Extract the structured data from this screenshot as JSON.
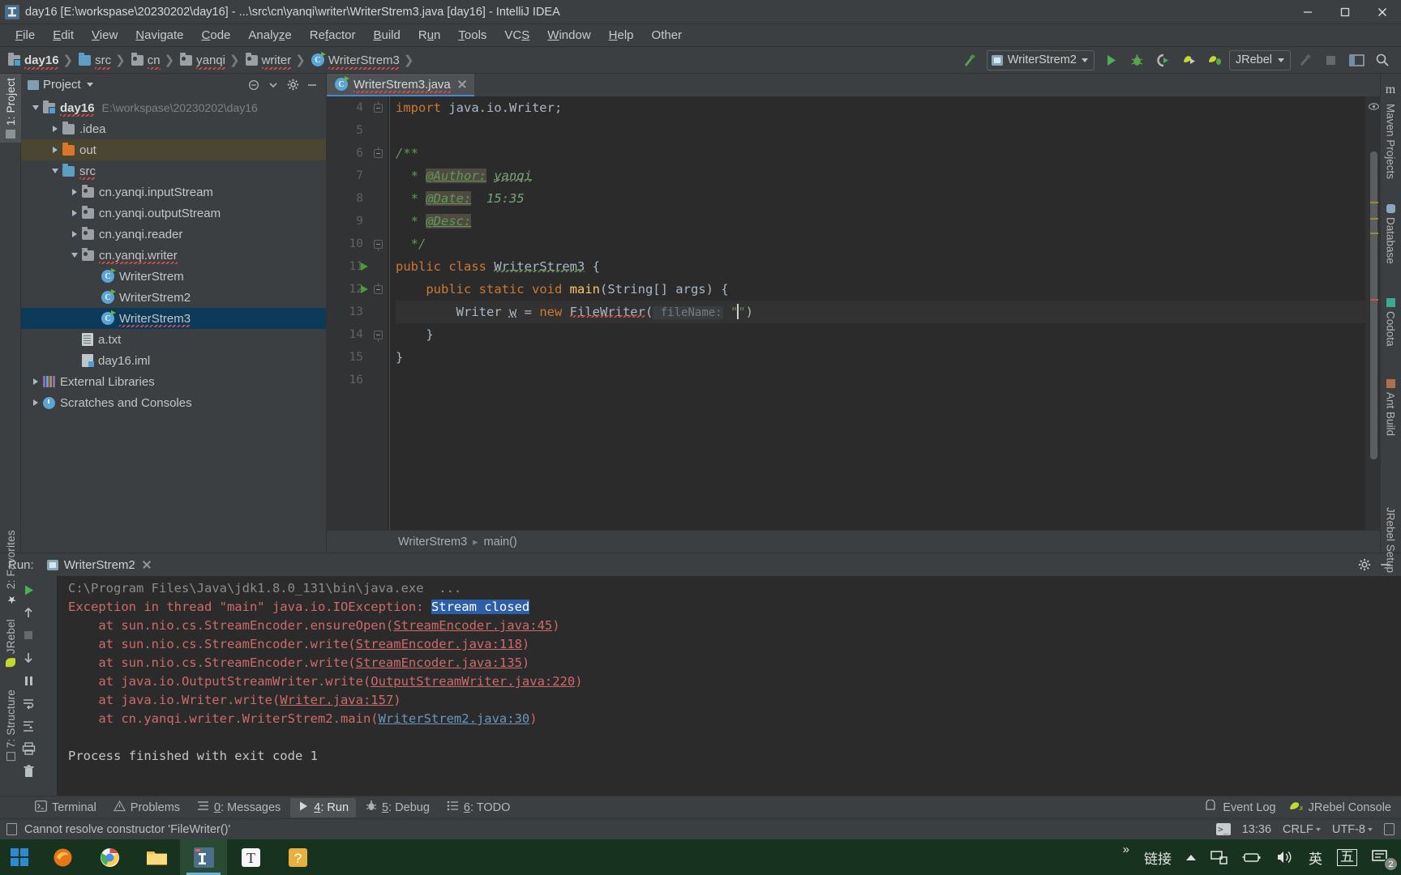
{
  "window": {
    "title": "day16 [E:\\workspase\\20230202\\day16] - ...\\src\\cn\\yanqi\\writer\\WriterStrem3.java [day16] - IntelliJ IDEA",
    "minimize_label": "Minimize",
    "maximize_label": "Maximize",
    "close_label": "Close"
  },
  "menubar": {
    "items": [
      {
        "label": "File"
      },
      {
        "label": "Edit"
      },
      {
        "label": "View"
      },
      {
        "label": "Navigate"
      },
      {
        "label": "Code"
      },
      {
        "label": "Analyze"
      },
      {
        "label": "Refactor"
      },
      {
        "label": "Build"
      },
      {
        "label": "Run"
      },
      {
        "label": "Tools"
      },
      {
        "label": "VCS"
      },
      {
        "label": "Window"
      },
      {
        "label": "Help"
      },
      {
        "label": "Other"
      }
    ]
  },
  "navbar": {
    "breadcrumbs": [
      {
        "label": "day16",
        "icon": "module-icon"
      },
      {
        "label": "src",
        "icon": "source-folder-icon"
      },
      {
        "label": "cn",
        "icon": "package-icon"
      },
      {
        "label": "yanqi",
        "icon": "package-icon"
      },
      {
        "label": "writer",
        "icon": "package-icon"
      },
      {
        "label": "WriterStrem3",
        "icon": "java-class-icon"
      }
    ],
    "run_config": "WriterStrem2",
    "jrebel_label": "JRebel",
    "buttons": [
      {
        "name": "build-hammer-icon"
      },
      {
        "name": "run-icon"
      },
      {
        "name": "debug-icon"
      },
      {
        "name": "run-with-coverage-icon"
      },
      {
        "name": "jrebel-run-icon"
      },
      {
        "name": "jrebel-debug-icon"
      },
      {
        "name": "attach-profiler-icon"
      },
      {
        "name": "stop-icon"
      },
      {
        "name": "layout-icon"
      },
      {
        "name": "search-everywhere-icon"
      }
    ]
  },
  "left_strip": {
    "tabs": [
      {
        "label": "1: Project",
        "selected": true
      },
      {
        "label": "2: Favorites",
        "selected": false
      },
      {
        "label": "JRebel",
        "selected": false
      },
      {
        "label": "7: Structure",
        "selected": false
      }
    ]
  },
  "right_strip": {
    "tabs": [
      {
        "label": "m"
      },
      {
        "label": "Maven Projects"
      },
      {
        "label": "Database"
      },
      {
        "label": "Codota"
      },
      {
        "label": "Ant Build"
      },
      {
        "label": "JRebel Setup Wizard"
      }
    ]
  },
  "project_panel": {
    "title": "Project",
    "actions": [
      "collapse-all-icon",
      "expand-icon",
      "settings-gear-icon",
      "hide-icon"
    ],
    "tree": [
      {
        "depth": 0,
        "arrow": "open",
        "icon": "module-icon",
        "name": "day16",
        "bold": true,
        "path": "E:\\workspase\\20230202\\day16",
        "state": "normal"
      },
      {
        "depth": 1,
        "arrow": "closed",
        "icon": "folder-grey-icon",
        "name": ".idea",
        "bold": false,
        "path": "",
        "state": "normal"
      },
      {
        "depth": 1,
        "arrow": "closed",
        "icon": "folder-orange-icon",
        "name": "out",
        "bold": false,
        "path": "",
        "state": "highlight"
      },
      {
        "depth": 1,
        "arrow": "open",
        "icon": "folder-source-icon",
        "name": "src",
        "bold": false,
        "path": "",
        "state": "normal"
      },
      {
        "depth": 2,
        "arrow": "closed",
        "icon": "package-icon",
        "name": "cn.yanqi.inputStream",
        "bold": false,
        "path": "",
        "state": "normal"
      },
      {
        "depth": 2,
        "arrow": "closed",
        "icon": "package-icon",
        "name": "cn.yanqi.outputStream",
        "bold": false,
        "path": "",
        "state": "normal"
      },
      {
        "depth": 2,
        "arrow": "closed",
        "icon": "package-icon",
        "name": "cn.yanqi.reader",
        "bold": false,
        "path": "",
        "state": "normal"
      },
      {
        "depth": 2,
        "arrow": "open",
        "icon": "package-icon",
        "name": "cn.yanqi.writer",
        "bold": false,
        "path": "",
        "state": "normal"
      },
      {
        "depth": 3,
        "arrow": "none",
        "icon": "java-class-icon",
        "name": "WriterStrem",
        "bold": false,
        "path": "",
        "state": "normal"
      },
      {
        "depth": 3,
        "arrow": "none",
        "icon": "java-class-icon",
        "name": "WriterStrem2",
        "bold": false,
        "path": "",
        "state": "normal"
      },
      {
        "depth": 3,
        "arrow": "none",
        "icon": "java-class-icon",
        "name": "WriterStrem3",
        "bold": false,
        "path": "",
        "state": "selected"
      },
      {
        "depth": 2,
        "arrow": "none",
        "icon": "text-file-icon",
        "name": "a.txt",
        "bold": false,
        "path": "",
        "state": "normal"
      },
      {
        "depth": 2,
        "arrow": "none",
        "icon": "iml-file-icon",
        "name": "day16.iml",
        "bold": false,
        "path": "",
        "state": "normal"
      },
      {
        "depth": 0,
        "arrow": "closed",
        "icon": "library-icon",
        "name": "External Libraries",
        "bold": false,
        "path": "",
        "state": "normal"
      },
      {
        "depth": 0,
        "arrow": "closed",
        "icon": "scratch-icon",
        "name": "Scratches and Consoles",
        "bold": false,
        "path": "",
        "state": "normal"
      }
    ]
  },
  "editor": {
    "tab": {
      "label": "WriterStrem3.java",
      "close_label": "Close tab"
    },
    "first_visible_line": 4,
    "lines": [
      {
        "num": 4,
        "run_marker": false,
        "fold": "top",
        "current": false,
        "tokens": [
          {
            "t": "import ",
            "c": "k"
          },
          {
            "t": "java.io.Writer;",
            "c": "id"
          }
        ]
      },
      {
        "num": 5,
        "run_marker": false,
        "fold": "",
        "current": false,
        "tokens": []
      },
      {
        "num": 6,
        "run_marker": false,
        "fold": "top",
        "current": false,
        "tokens": [
          {
            "t": "/**",
            "c": "cm"
          }
        ]
      },
      {
        "num": 7,
        "run_marker": false,
        "fold": "",
        "current": false,
        "tokens": [
          {
            "t": "  * ",
            "c": "cm"
          },
          {
            "t": "@Author:",
            "c": "tag"
          },
          {
            "t": " ",
            "c": "cm"
          },
          {
            "t": "yanqi",
            "c": "cmv-squig"
          }
        ]
      },
      {
        "num": 8,
        "run_marker": false,
        "fold": "",
        "current": false,
        "tokens": [
          {
            "t": "  * ",
            "c": "cm"
          },
          {
            "t": "@Date:",
            "c": "tag"
          },
          {
            "t": "  15:35",
            "c": "cmv"
          }
        ]
      },
      {
        "num": 9,
        "run_marker": false,
        "fold": "",
        "current": false,
        "tokens": [
          {
            "t": "  * ",
            "c": "cm"
          },
          {
            "t": "@Desc:",
            "c": "tag"
          }
        ]
      },
      {
        "num": 10,
        "run_marker": false,
        "fold": "bottom",
        "current": false,
        "tokens": [
          {
            "t": "  */",
            "c": "cm"
          }
        ]
      },
      {
        "num": 11,
        "run_marker": true,
        "fold": "",
        "current": false,
        "tokens": [
          {
            "t": "public class ",
            "c": "k"
          },
          {
            "t": "WriterStrem3",
            "c": "id-squig"
          },
          {
            "t": " {",
            "c": "id"
          }
        ]
      },
      {
        "num": 12,
        "run_marker": true,
        "fold": "top",
        "current": false,
        "tokens": [
          {
            "t": "    ",
            "c": "id"
          },
          {
            "t": "public static ",
            "c": "k"
          },
          {
            "t": "void ",
            "c": "k"
          },
          {
            "t": "main",
            "c": "mn"
          },
          {
            "t": "(String[] args) {",
            "c": "id"
          }
        ]
      },
      {
        "num": 13,
        "run_marker": false,
        "fold": "",
        "current": true,
        "tokens": [
          {
            "t": "        Writer ",
            "c": "id"
          },
          {
            "t": "w",
            "c": "fld"
          },
          {
            "t": " = ",
            "c": "id"
          },
          {
            "t": "new ",
            "c": "k"
          },
          {
            "t": "FileWriter",
            "c": "id-err"
          },
          {
            "t": "(",
            "c": "id"
          },
          {
            "t": " fileName:",
            "c": "hint"
          },
          {
            "t": " ",
            "c": "id"
          },
          {
            "t": "\"",
            "c": "str"
          },
          {
            "t": "|CARET|",
            "c": "caret"
          },
          {
            "t": "\"",
            "c": "str"
          },
          {
            "t": ")",
            "c": "id"
          }
        ]
      },
      {
        "num": 14,
        "run_marker": false,
        "fold": "bottom",
        "current": false,
        "tokens": [
          {
            "t": "    }",
            "c": "id"
          }
        ]
      },
      {
        "num": 15,
        "run_marker": false,
        "fold": "",
        "current": false,
        "tokens": [
          {
            "t": "}",
            "c": "id"
          }
        ]
      },
      {
        "num": 16,
        "run_marker": false,
        "fold": "",
        "current": false,
        "tokens": []
      }
    ],
    "breadcrumb": [
      "WriterStrem3",
      "main()"
    ]
  },
  "run_panel": {
    "label": "Run:",
    "tab_name": "WriterStrem2",
    "tab_close_label": "Close",
    "gutter_buttons": [
      "rerun-icon",
      "up-arrow-icon",
      "stop-icon",
      "down-arrow-icon",
      "pause-icon",
      "soft-wrap-icon",
      "scroll-to-end-icon",
      "print-icon",
      "trash-icon"
    ],
    "settings_label": "Settings",
    "minimize_label": "Hide",
    "console": [
      {
        "type": "cmd",
        "text": "C:\\Program Files\\Java\\jdk1.8.0_131\\bin\\java.exe  ..."
      },
      {
        "type": "exc",
        "pre": "Exception in thread \"main\" java.io.IOException: ",
        "sel": "Stream closed"
      },
      {
        "type": "at",
        "indent": "    at ",
        "call": "sun.nio.cs.StreamEncoder.ensureOpen(",
        "link": "StreamEncoder.java:45",
        "tail": ")",
        "blue": false
      },
      {
        "type": "at",
        "indent": "    at ",
        "call": "sun.nio.cs.StreamEncoder.write(",
        "link": "StreamEncoder.java:118",
        "tail": ")",
        "blue": false
      },
      {
        "type": "at",
        "indent": "    at ",
        "call": "sun.nio.cs.StreamEncoder.write(",
        "link": "StreamEncoder.java:135",
        "tail": ")",
        "blue": false
      },
      {
        "type": "at",
        "indent": "    at ",
        "call": "java.io.OutputStreamWriter.write(",
        "link": "OutputStreamWriter.java:220",
        "tail": ")",
        "blue": false
      },
      {
        "type": "at",
        "indent": "    at ",
        "call": "java.io.Writer.write(",
        "link": "Writer.java:157",
        "tail": ")",
        "blue": false
      },
      {
        "type": "at",
        "indent": "    at ",
        "call": "cn.yanqi.writer.WriterStrem2.main(",
        "link": "WriterStrem2.java:30",
        "tail": ")",
        "blue": true
      },
      {
        "type": "blank",
        "text": ""
      },
      {
        "type": "info",
        "text": "Process finished with exit code 1"
      }
    ]
  },
  "tool_tabs": {
    "items": [
      {
        "label": "Terminal",
        "icon": "terminal-icon",
        "active": false,
        "mnemonic": ""
      },
      {
        "label": "Problems",
        "icon": "warning-icon",
        "active": false,
        "mnemonic": ""
      },
      {
        "label": "0: Messages",
        "icon": "messages-icon",
        "active": false,
        "mnemonic": "0"
      },
      {
        "label": "4: Run",
        "icon": "run-icon",
        "active": true,
        "mnemonic": "4"
      },
      {
        "label": "5: Debug",
        "icon": "debug-icon",
        "active": false,
        "mnemonic": "5"
      },
      {
        "label": "6: TODO",
        "icon": "todo-icon",
        "active": false,
        "mnemonic": "6"
      }
    ],
    "right": [
      {
        "label": "Event Log",
        "icon": "event-log-icon"
      },
      {
        "label": "JRebel Console",
        "icon": "jrebel-icon"
      }
    ]
  },
  "statusbar": {
    "message": "Cannot resolve constructor 'FileWriter()'",
    "message_icon": "inspection-icon",
    "terminal_icon": "terminal-icon",
    "time": "13:36",
    "line_separator": "CRLF",
    "encoding": "UTF-8",
    "lock_icon": "read-only-icon"
  },
  "taskbar": {
    "start_label": "Start",
    "apps": [
      {
        "name": "firefox-icon"
      },
      {
        "name": "chrome-icon"
      },
      {
        "name": "file-explorer-icon"
      },
      {
        "name": "intellij-idea-icon",
        "active": true
      },
      {
        "name": "typora-icon"
      },
      {
        "name": "unknown-app-icon"
      }
    ],
    "tray": {
      "overflow": "»",
      "network_label": "链接",
      "ime_lang": "英",
      "ime_mode": "五",
      "notification_count": "2"
    }
  }
}
